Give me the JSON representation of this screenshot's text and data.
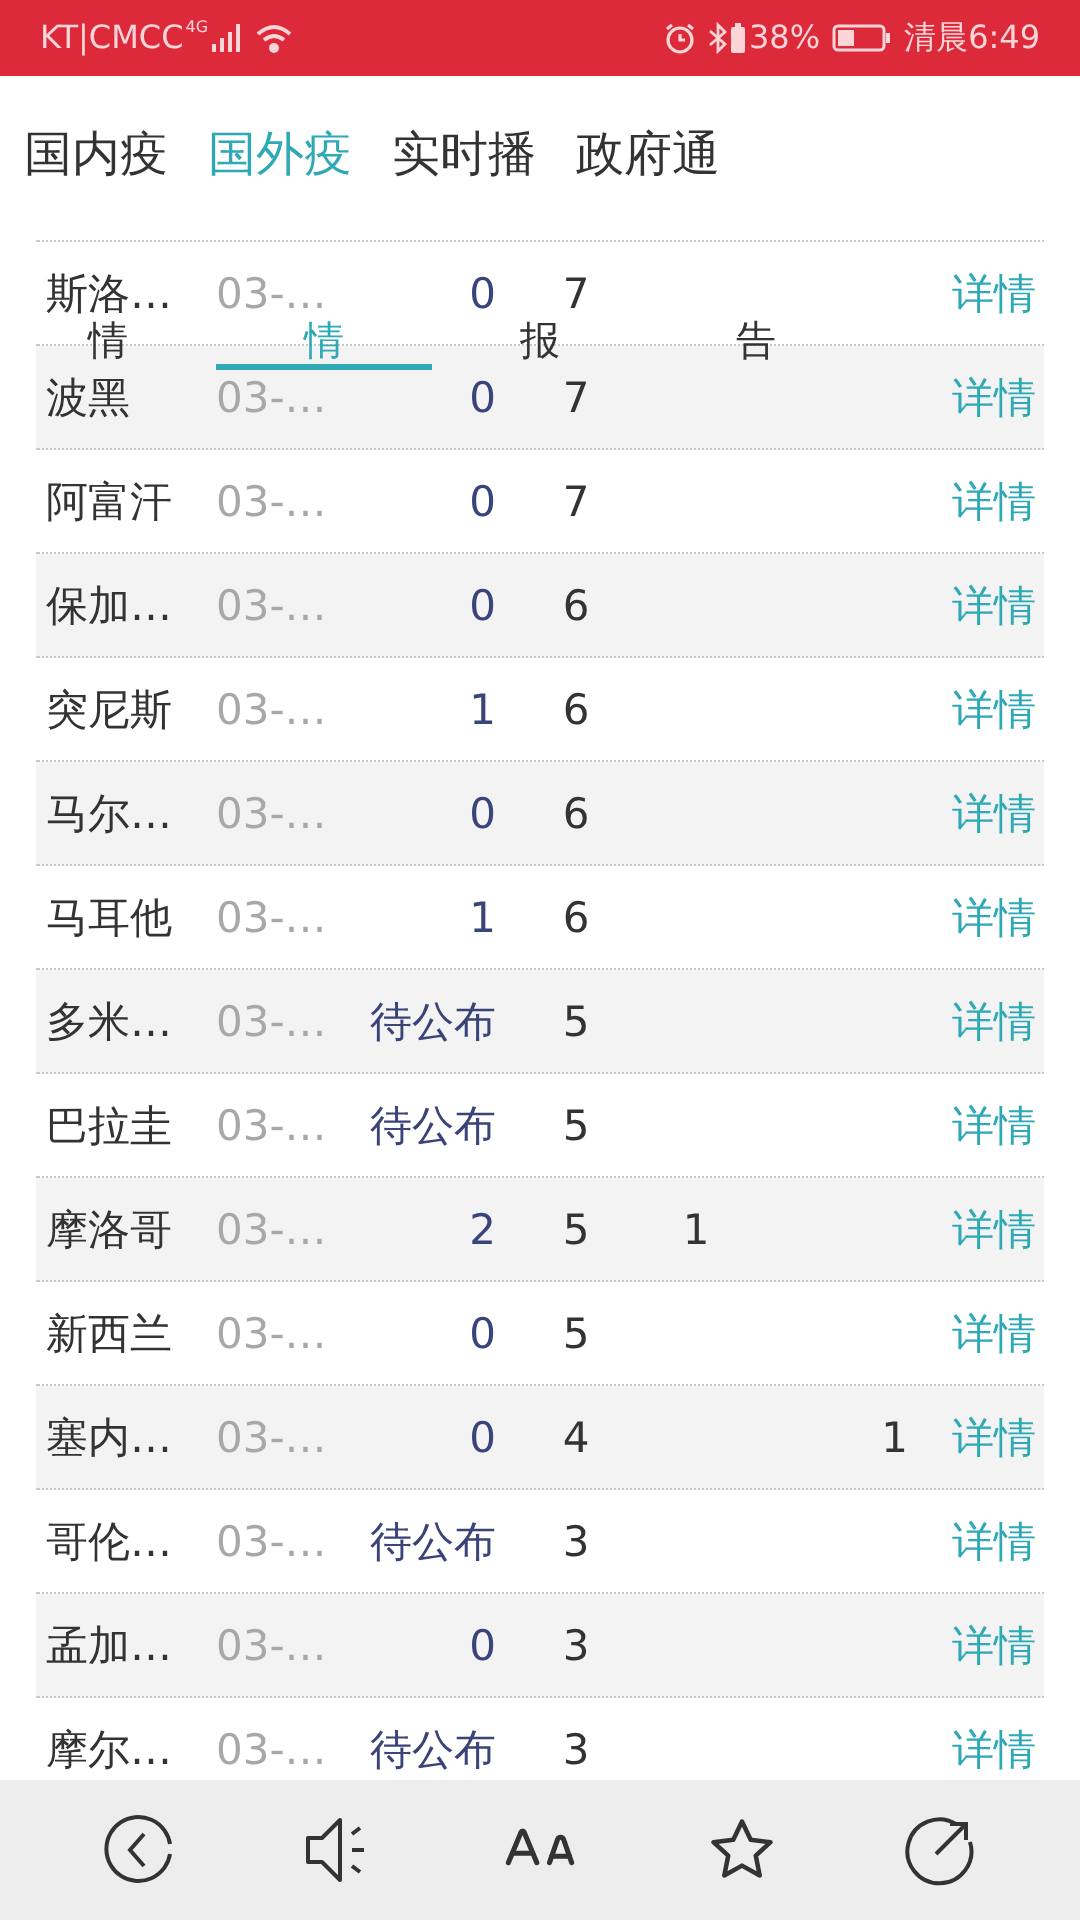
{
  "status_bar": {
    "carrier": "KT|CMCC",
    "network": "4G",
    "battery": "38%",
    "time": "清晨6:49"
  },
  "tabs": [
    {
      "label": "国内疫",
      "selected": false
    },
    {
      "label": "国外疫",
      "selected": true
    },
    {
      "label": "实时播",
      "selected": false
    },
    {
      "label": "政府通",
      "selected": false
    }
  ],
  "sub_tabs": [
    {
      "label": "情",
      "selected": false
    },
    {
      "label": "情",
      "selected": true
    },
    {
      "label": "报",
      "selected": false
    },
    {
      "label": "告",
      "selected": false
    }
  ],
  "rows": [
    {
      "name": "斯洛…",
      "date": "03-…",
      "column_3": "0",
      "column_4": "7",
      "link": "详情"
    },
    {
      "name": "波黑",
      "date": "03-…",
      "column_3": "0",
      "column_4": "7",
      "link": "详情"
    },
    {
      "name": "阿富汗",
      "date": "03-…",
      "column_3": "0",
      "column_4": "7",
      "link": "详情"
    },
    {
      "name": "保加…",
      "date": "03-…",
      "column_3": "0",
      "column_4": "6",
      "link": "详情"
    },
    {
      "name": "突尼斯",
      "date": "03-…",
      "column_3": "1",
      "column_4": "6",
      "link": "详情"
    },
    {
      "name": "马尔…",
      "date": "03-…",
      "column_3": "0",
      "column_4": "6",
      "link": "详情"
    },
    {
      "name": "马耳他",
      "date": "03-…",
      "column_3": "1",
      "column_4": "6",
      "link": "详情"
    },
    {
      "name": "多米…",
      "date": "03-…",
      "column_3": "待公布",
      "column_4": "5",
      "link": "详情"
    },
    {
      "name": "巴拉圭",
      "date": "03-…",
      "column_3": "待公布",
      "column_4": "5",
      "link": "详情"
    },
    {
      "name": "摩洛哥",
      "date": "03-…",
      "column_3": "2",
      "column_4": "5",
      "column_5": "1",
      "link": "详情"
    },
    {
      "name": "新西兰",
      "date": "03-…",
      "column_3": "0",
      "column_4": "5",
      "link": "详情"
    },
    {
      "name": "塞内…",
      "date": "03-…",
      "column_3": "0",
      "column_4": "4",
      "column_6": "1",
      "link": "详情"
    },
    {
      "name": "哥伦…",
      "date": "03-…",
      "column_3": "待公布",
      "column_4": "3",
      "link": "详情"
    },
    {
      "name": "孟加…",
      "date": "03-…",
      "column_3": "0",
      "column_4": "3",
      "link": "详情"
    },
    {
      "name": "摩尔…",
      "date": "03-…",
      "column_3": "待公布",
      "column_4": "3",
      "link": "详情"
    }
  ]
}
